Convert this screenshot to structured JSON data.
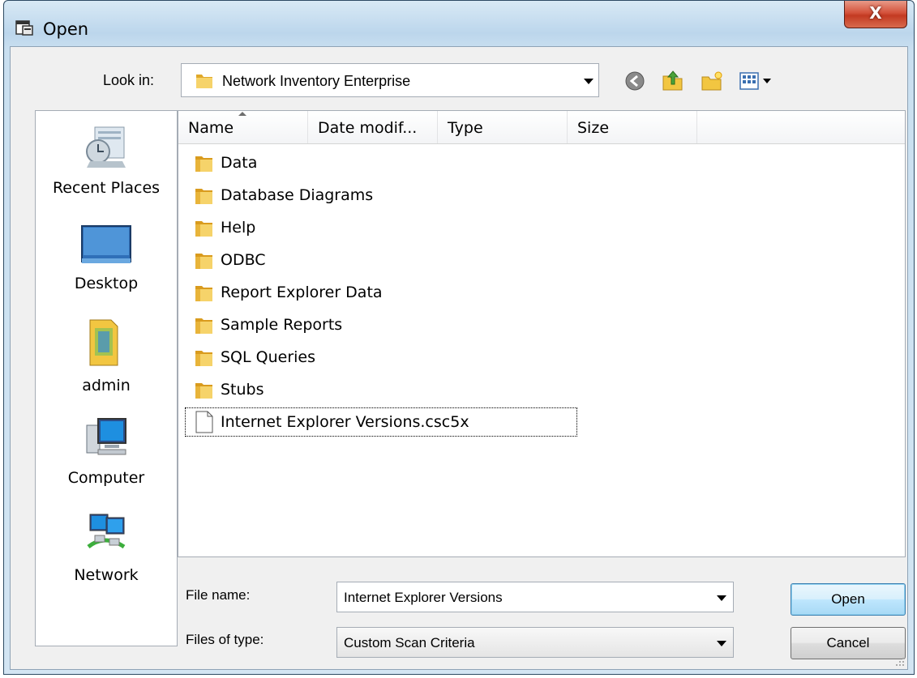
{
  "window": {
    "title": "Open",
    "close_glyph": "X"
  },
  "look_in": {
    "label": "Look in:",
    "value": "Network Inventory Enterprise"
  },
  "toolbar": [
    {
      "name": "back-icon"
    },
    {
      "name": "up-folder-icon"
    },
    {
      "name": "new-folder-icon"
    },
    {
      "name": "view-menu-icon"
    }
  ],
  "places": [
    {
      "label": "Recent Places",
      "icon": "recent-places-icon"
    },
    {
      "label": "Desktop",
      "icon": "desktop-icon"
    },
    {
      "label": "admin",
      "icon": "user-folder-icon"
    },
    {
      "label": "Computer",
      "icon": "computer-icon"
    },
    {
      "label": "Network",
      "icon": "network-icon"
    }
  ],
  "columns": [
    "Name",
    "Date modif...",
    "Type",
    "Size"
  ],
  "files": [
    {
      "name": "Data",
      "kind": "folder"
    },
    {
      "name": "Database Diagrams",
      "kind": "folder"
    },
    {
      "name": "Help",
      "kind": "folder"
    },
    {
      "name": "ODBC",
      "kind": "folder"
    },
    {
      "name": "Report Explorer Data",
      "kind": "folder"
    },
    {
      "name": "Sample Reports",
      "kind": "folder"
    },
    {
      "name": "SQL Queries",
      "kind": "folder"
    },
    {
      "name": "Stubs",
      "kind": "folder"
    },
    {
      "name": "Internet Explorer Versions.csc5x",
      "kind": "file",
      "selected": true
    }
  ],
  "file_name": {
    "label": "File name:",
    "value": "Internet Explorer Versions"
  },
  "files_of_type": {
    "label": "Files of type:",
    "value": "Custom Scan Criteria"
  },
  "buttons": {
    "open": "Open",
    "cancel": "Cancel"
  },
  "colors": {
    "folder": "#f2c641",
    "titlebar": "#bcd6ec",
    "close": "#c33a22"
  }
}
